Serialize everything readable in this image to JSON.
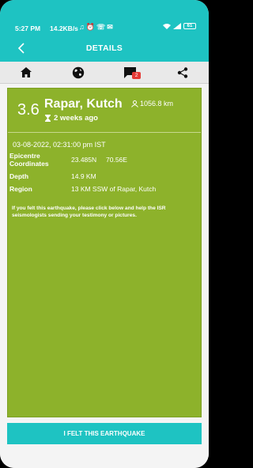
{
  "status": {
    "time": "5:27 PM",
    "speed": "14.2KB/s",
    "battery": "61"
  },
  "app_bar": {
    "title": "DETAILS"
  },
  "tabs": [
    {
      "icon": "home-icon"
    },
    {
      "icon": "globe-icon"
    },
    {
      "icon": "chat-icon",
      "badge": "2"
    },
    {
      "icon": "share-icon"
    }
  ],
  "quake": {
    "magnitude": "3.6",
    "place": "Rapar, Kutch",
    "distance": "1056.8 km",
    "ago": "2 weeks ago",
    "datetime": "03-08-2022, 02:31:00 pm IST",
    "labels": {
      "epicentre": "Epicentre Coordinates",
      "depth": "Depth",
      "region": "Region"
    },
    "lat": "23.485N",
    "lon": "70.56E",
    "depth": "14.9 KM",
    "region": "13 KM SSW of Rapar, Kutch"
  },
  "notice": "If you felt this earthquake, please click below and help the ISR seismologists sending your testimony or pictures.",
  "button": {
    "label": "I FELT THIS EARTHQUAKE"
  },
  "colors": {
    "teal": "#1ec3c2",
    "green": "#8db22b",
    "badge": "#e53935"
  }
}
